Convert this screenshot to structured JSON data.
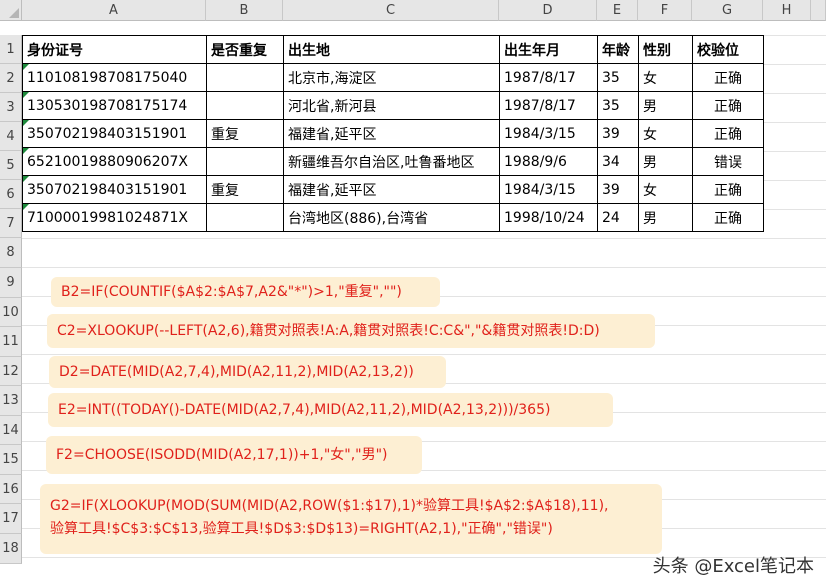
{
  "columns": [
    "A",
    "B",
    "C",
    "D",
    "E",
    "F",
    "G",
    "H"
  ],
  "rows": [
    "1",
    "2",
    "3",
    "4",
    "5",
    "6",
    "7",
    "8",
    "9",
    "10",
    "11",
    "12",
    "13",
    "14",
    "15",
    "16",
    "17",
    "18"
  ],
  "table": {
    "headers": [
      "身份证号",
      "是否重复",
      "出生地",
      "出生年月",
      "年龄",
      "性别",
      "校验位"
    ],
    "rows": [
      [
        "110108198708175040",
        "",
        "北京市,海淀区",
        "1987/8/17",
        "35",
        "女",
        "正确"
      ],
      [
        "130530198708175174",
        "",
        "河北省,新河县",
        "1987/8/17",
        "35",
        "男",
        "正确"
      ],
      [
        "350702198403151901",
        "重复",
        "福建省,延平区",
        "1984/3/15",
        "39",
        "女",
        "正确"
      ],
      [
        "65210019880906207X",
        "",
        "新疆维吾尔自治区,吐鲁番地区",
        "1988/9/6",
        "34",
        "男",
        "错误"
      ],
      [
        "350702198403151901",
        "重复",
        "福建省,延平区",
        "1984/3/15",
        "39",
        "女",
        "正确"
      ],
      [
        "71000019981024871X",
        "",
        "台湾地区(886),台湾省",
        "1998/10/24",
        "24",
        "男",
        "正确"
      ]
    ]
  },
  "formulas": {
    "b2": "B2=IF(COUNTIF($A$2:$A$7,A2&\"*\")>1,\"重复\",\"\")",
    "c2": "C2=XLOOKUP(--LEFT(A2,6),籍贯对照表!A:A,籍贯对照表!C:C&\",\"&籍贯对照表!D:D)",
    "d2": "D2=DATE(MID(A2,7,4),MID(A2,11,2),MID(A2,13,2))",
    "e2": "E2=INT((TODAY()-DATE(MID(A2,7,4),MID(A2,11,2),MID(A2,13,2)))/365)",
    "f2": "F2=CHOOSE(ISODD(MID(A2,17,1))+1,\"女\",\"男\")",
    "g2_line1": "G2=IF(XLOOKUP(MOD(SUM(MID(A2,ROW($1:$17),1)*验算工具!$A$2:$A$18),11),",
    "g2_line2": "验算工具!$C$3:$C$13,验算工具!$D$3:$D$13)=RIGHT(A2,1),\"正确\",\"错误\")"
  },
  "watermark": "头条 @Excel笔记本"
}
